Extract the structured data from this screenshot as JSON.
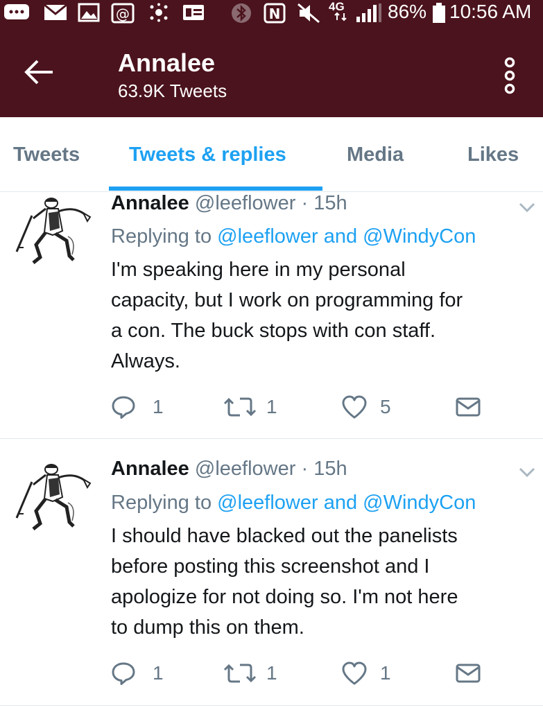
{
  "status_bar": {
    "battery": "86%",
    "time": "10:56 AM",
    "network": "4G",
    "icons": [
      "message-icon",
      "email-icon",
      "gallery-icon",
      "at-icon",
      "dots-icon",
      "card-icon",
      "bluetooth-icon",
      "nfc-icon",
      "mute-icon",
      "network-icon",
      "signal-icon",
      "battery-icon"
    ]
  },
  "header": {
    "name": "Annalee",
    "tweet_count": "63.9K Tweets",
    "icons": [
      "back-arrow-icon",
      "overflow-menu-icon"
    ]
  },
  "tabs": [
    {
      "label": "Tweets",
      "active": false
    },
    {
      "label": "Tweets & replies",
      "active": true
    },
    {
      "label": "Media",
      "active": false
    },
    {
      "label": "Likes",
      "active": false
    }
  ],
  "tweets": [
    {
      "name": "Annalee",
      "handle": "@leeflower",
      "dot": "·",
      "time": "15h",
      "replying_prefix": "Replying to",
      "mention_1": "@leeflower",
      "conjunction": "and",
      "mention_2": "@WindyCon",
      "lines": [
        "I'm speaking here in my personal",
        "capacity, but I work on programming for",
        "a con. The buck stops with con staff.",
        "Always."
      ],
      "replies": "1",
      "retweets": "1",
      "likes": "5"
    },
    {
      "name": "Annalee",
      "handle": "@leeflower",
      "dot": "·",
      "time": "15h",
      "replying_prefix": "Replying to",
      "mention_1": "@leeflower",
      "conjunction": "and",
      "mention_2": "@WindyCon",
      "lines": [
        "I should have blacked out the panelists",
        "before posting this screenshot and I",
        "apologize for not doing so. I'm not here",
        "to dump this on them."
      ],
      "replies": "1",
      "retweets": "1",
      "likes": "1"
    }
  ],
  "colors": {
    "bar": "#4b131d",
    "accent": "#1da1f2",
    "muted": "#657786",
    "divider": "#e1e8ed"
  }
}
